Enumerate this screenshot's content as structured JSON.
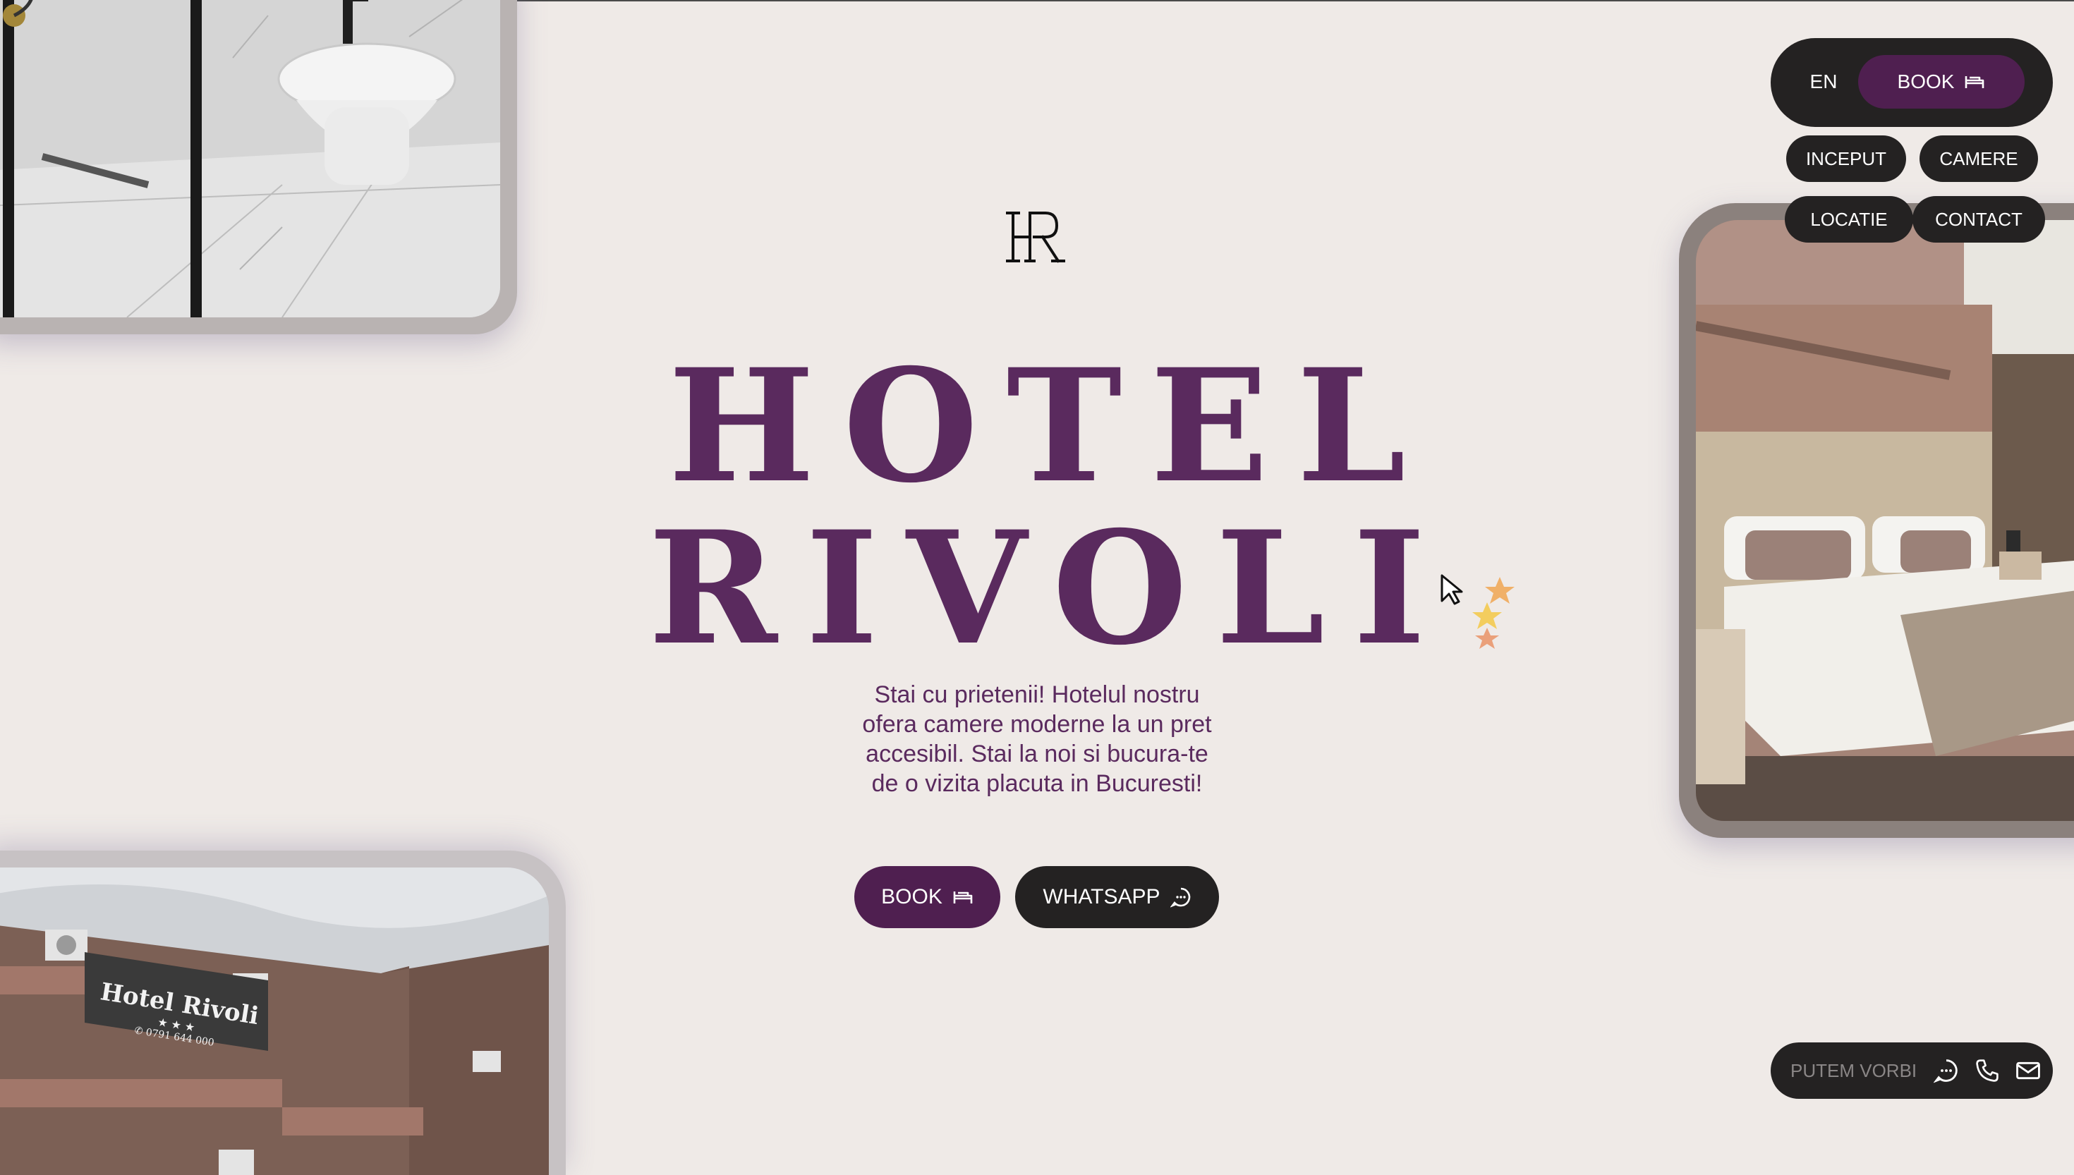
{
  "header": {
    "lang_label": "EN",
    "book_label": "BOOK",
    "nav": [
      {
        "label": "INCEPUT"
      },
      {
        "label": "CAMERE"
      },
      {
        "label": "LOCATIE"
      },
      {
        "label": "CONTACT"
      }
    ]
  },
  "hero": {
    "logo_text": "HR",
    "title_line1": "HOTEL",
    "title_line2": "RIVOLI",
    "tagline": "Stai cu prietenii! Hotelul nostru ofera camere moderne la un pret accesibil. Stai la noi si bucura-te de o vizita placuta in Bucuresti!",
    "book_label": "BOOK",
    "whatsapp_label": "WHATSAPP"
  },
  "photos": {
    "facade_sign": "Hotel Rivoli",
    "facade_sign_stars": "★ ★ ★",
    "facade_sign_phone": "✆ 0791 644 000"
  },
  "contact_bar": {
    "label": "PUTEM VORBI",
    "icons": [
      "chat-icon",
      "phone-icon",
      "mail-icon"
    ]
  },
  "colors": {
    "background": "#efeae7",
    "brand_purple": "#5a2a5e",
    "button_purple": "#4f1f50",
    "button_dark": "#242222"
  }
}
